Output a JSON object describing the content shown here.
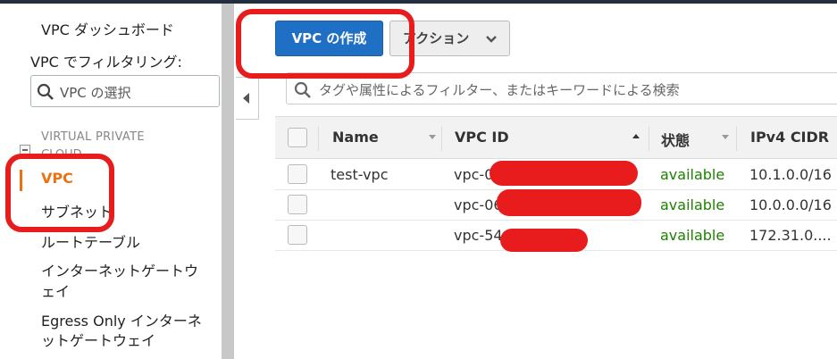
{
  "sidebar": {
    "dashboard": "VPC ダッシュボード",
    "filter_label": "VPC でフィルタリング:",
    "search_placeholder": "VPC の選択",
    "section_title": "VIRTUAL PRIVATE",
    "section_title_2": "CLOUD",
    "items": [
      {
        "label": "VPC",
        "active": true
      },
      {
        "label": "サブネット"
      },
      {
        "label": "ルートテーブル"
      },
      {
        "label": "インターネットゲートウ"
      },
      {
        "label": "ェイ"
      },
      {
        "label": "Egress Only インターネ"
      },
      {
        "label": "ットゲートウェイ"
      }
    ]
  },
  "toolbar": {
    "create_label": "VPC の作成",
    "actions_label": "アクション"
  },
  "filter": {
    "placeholder": "タグや属性によるフィルター、またはキーワードによる検索"
  },
  "table": {
    "columns": [
      "Name",
      "VPC ID",
      "状態",
      "IPv4 CIDR"
    ],
    "rows": [
      {
        "name": "test-vpc",
        "vpc_id": "vpc-0",
        "status": "available",
        "cidr": "10.1.0.0/16"
      },
      {
        "name": "",
        "vpc_id": "vpc-06",
        "status": "available",
        "cidr": "10.0.0.0/16"
      },
      {
        "name": "",
        "vpc_id": "vpc-54",
        "status": "available",
        "cidr": "172.31.0...."
      }
    ]
  },
  "colors": {
    "primary": "#1f6fc4",
    "active": "#ec7211",
    "status_ok": "#1d8102",
    "annotation": "#e81c1c"
  }
}
